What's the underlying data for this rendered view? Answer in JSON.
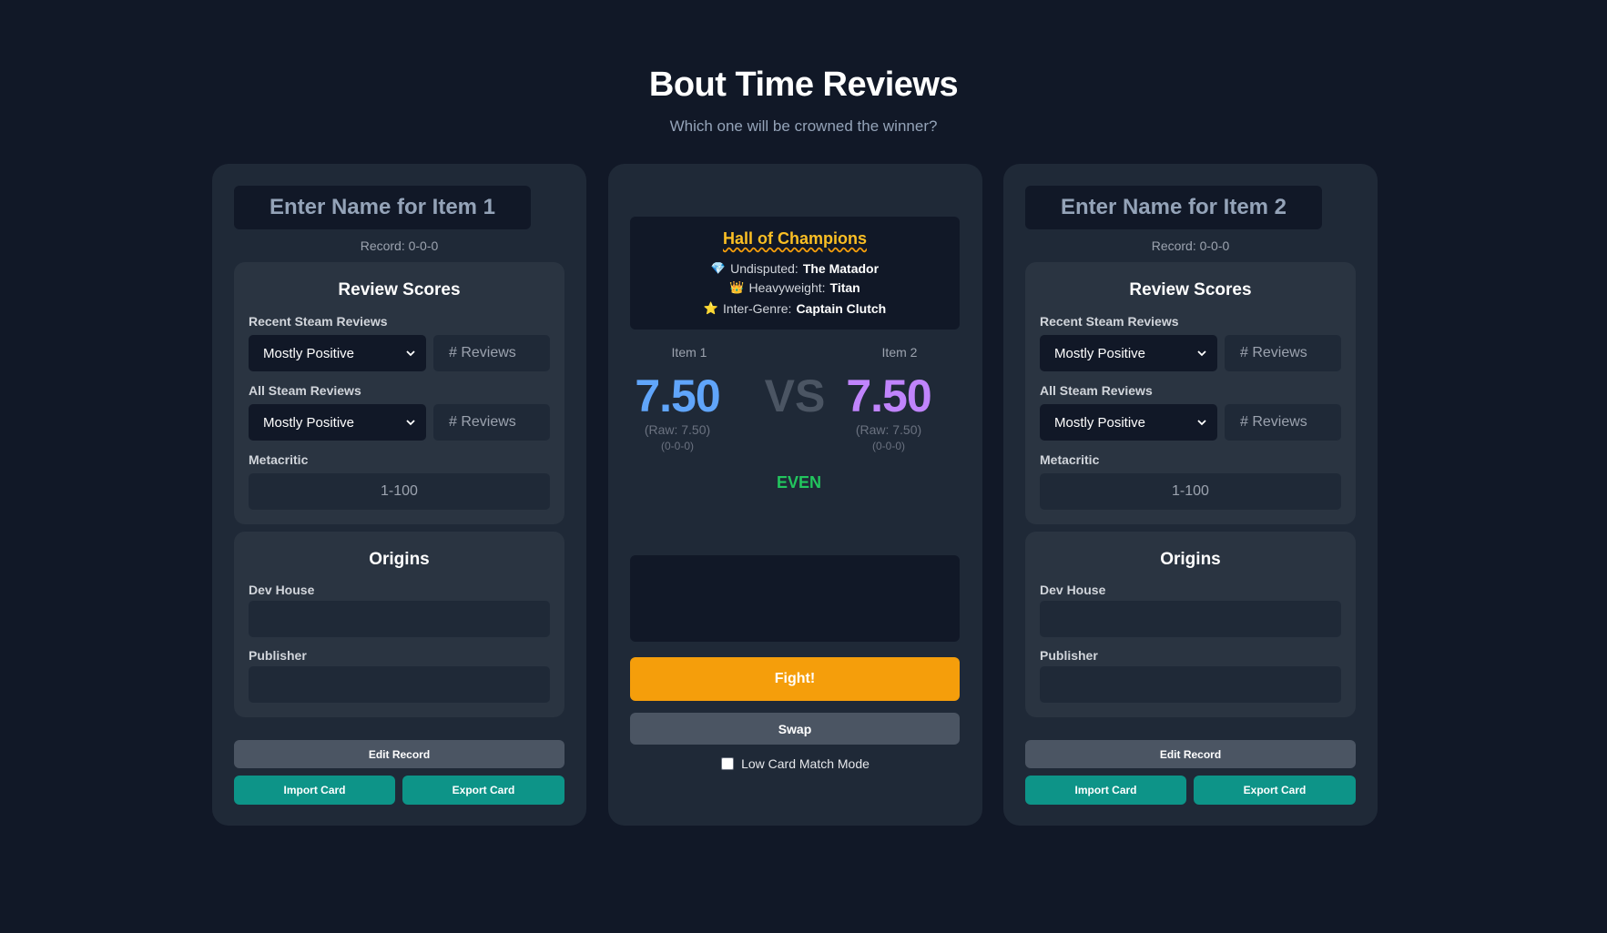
{
  "header": {
    "title": "Bout Time Reviews",
    "subtitle": "Which one will be crowned the winner?"
  },
  "item1": {
    "name_placeholder": "Enter Name for Item 1",
    "record": "Record: 0-0-0",
    "scores_title": "Review Scores",
    "recent_label": "Recent Steam Reviews",
    "recent_value": "Mostly Positive",
    "recent_count_placeholder": "# Reviews",
    "all_label": "All Steam Reviews",
    "all_value": "Mostly Positive",
    "all_count_placeholder": "# Reviews",
    "metacritic_label": "Metacritic",
    "metacritic_placeholder": "1-100",
    "origins_title": "Origins",
    "dev_label": "Dev House",
    "dev_value": "",
    "publisher_label": "Publisher",
    "publisher_value": "",
    "edit_label": "Edit Record",
    "import_label": "Import Card",
    "export_label": "Export Card"
  },
  "item2": {
    "name_placeholder": "Enter Name for Item 2",
    "record": "Record: 0-0-0",
    "scores_title": "Review Scores",
    "recent_label": "Recent Steam Reviews",
    "recent_value": "Mostly Positive",
    "recent_count_placeholder": "# Reviews",
    "all_label": "All Steam Reviews",
    "all_value": "Mostly Positive",
    "all_count_placeholder": "# Reviews",
    "metacritic_label": "Metacritic",
    "metacritic_placeholder": "1-100",
    "origins_title": "Origins",
    "dev_label": "Dev House",
    "dev_value": "",
    "publisher_label": "Publisher",
    "publisher_value": "",
    "edit_label": "Edit Record",
    "import_label": "Import Card",
    "export_label": "Export Card"
  },
  "hall": {
    "title": "Hall of Champions",
    "rows": [
      {
        "icon": "💎",
        "icon_name": "gem-icon",
        "label": "Undisputed:",
        "value": "The Matador"
      },
      {
        "icon": "👑",
        "icon_name": "crown-icon",
        "label": "Heavyweight:",
        "value": "Titan"
      },
      {
        "icon": "⭐",
        "icon_name": "star-icon",
        "label": "Inter-Genre:",
        "value": "Captain Clutch"
      }
    ]
  },
  "battle": {
    "item1_label": "Item 1",
    "item2_label": "Item 2",
    "item1_score": "7.50",
    "item2_score": "7.50",
    "vs": "VS",
    "item1_raw": "(Raw: 7.50)",
    "item2_raw": "(Raw: 7.50)",
    "item1_record": "(0-0-0)",
    "item2_record": "(0-0-0)",
    "verdict": "EVEN",
    "fight_label": "Fight!",
    "swap_label": "Swap",
    "low_card_label": "Low Card Match Mode"
  },
  "colors": {
    "background": "#111827",
    "card": "#1f2937",
    "panel": "#2a3441",
    "item1_score": "#60a5fa",
    "item2_score": "#c084fc",
    "fight": "#f59e0b",
    "teal": "#0d9488",
    "even": "#22c55e",
    "hall_title": "#fbbf24"
  }
}
